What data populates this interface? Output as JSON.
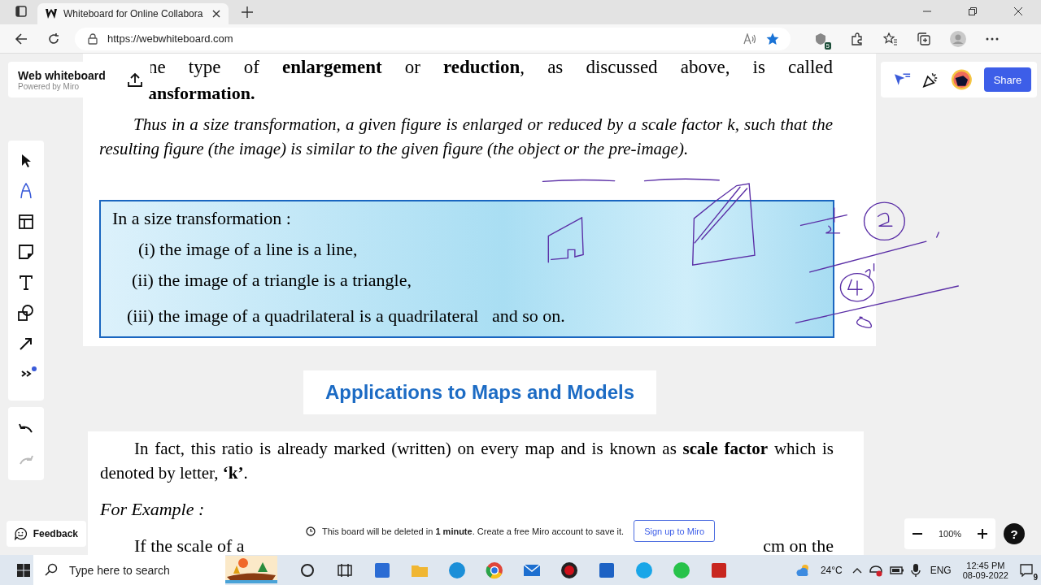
{
  "browser": {
    "tabs": [
      {
        "title": "Whiteboard for Online Collabora",
        "selected": true
      }
    ],
    "url": "https://webwhiteboard.com",
    "extension_badge": "5"
  },
  "board": {
    "brand": {
      "title": "Web whiteboard",
      "subtitle": "Powered by Miro"
    },
    "tools": [
      {
        "kind": "select",
        "selected": false,
        "dot": false
      },
      {
        "kind": "pen",
        "selected": true,
        "dot": false
      },
      {
        "kind": "frame",
        "selected": false,
        "dot": false
      },
      {
        "kind": "sticky",
        "selected": false,
        "dot": false
      },
      {
        "kind": "text",
        "selected": false,
        "dot": false
      },
      {
        "kind": "shapes",
        "selected": false,
        "dot": false
      },
      {
        "kind": "arrow",
        "selected": false,
        "dot": false
      },
      {
        "kind": "more",
        "selected": false,
        "dot": true
      }
    ],
    "history": [
      {
        "kind": "undo",
        "disabled": false
      },
      {
        "kind": "redo",
        "disabled": true
      }
    ],
    "share": "Share",
    "feedback": "Feedback",
    "toast": {
      "text": "This board will be deleted in **1 minute**. Create a free Miro account to save it.",
      "button": "Sign up to Miro"
    },
    "zoom": "100%",
    "help": "?"
  },
  "page_1": {
    "line_1": "ne type of **enlargement** or **reduction**, as discussed above, is called",
    "line_2": "ansformation.",
    "paragraph": "Thus in a size transformation, a given figure is enlarged or reduced by a scale factor k, such that the resulting figure (the image) is similar to the given figure (the object or the pre-image).",
    "box_heading": "In a size transformation :",
    "box_items": [
      "(i) the image of a line is a line,",
      "(ii) the image of a triangle is a triangle,",
      "(iii) the image of a quadrilateral is a quadrilateral   and so on."
    ]
  },
  "section_heading": "Applications to Maps and Models",
  "page_2": {
    "paragraph": "In fact, this ratio is already marked (written) on every map and is known as **scale factor** which is denoted by letter, **‘k’**.",
    "example_label": "For Example :",
    "last_line_start": "If the scale of a",
    "last_line_end": "cm on the"
  },
  "taskbar": {
    "search_placeholder": "Type here to search",
    "weather": "24°C",
    "language": "ENG",
    "time": "12:45 PM",
    "date": "08-09-2022",
    "notifications": "9"
  }
}
